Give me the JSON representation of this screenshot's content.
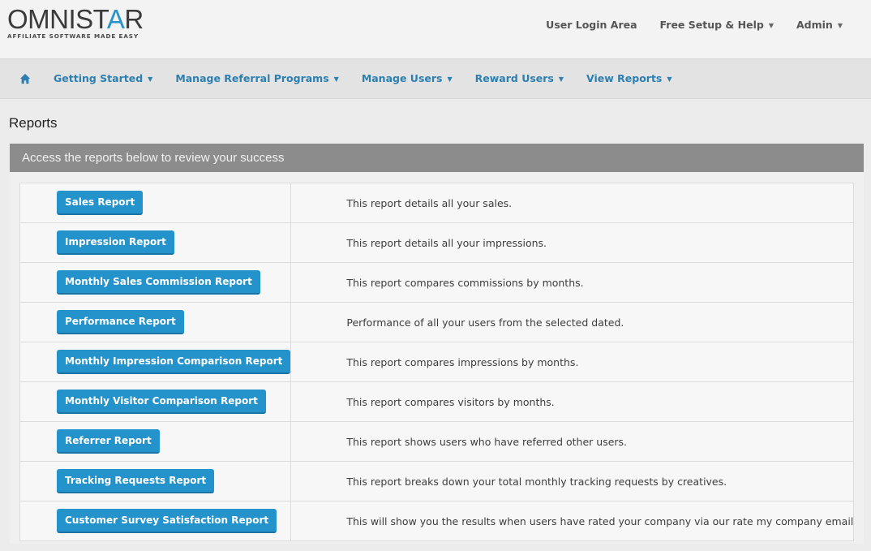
{
  "brand": {
    "name_part1": "OMNIST",
    "name_part2": "A",
    "name_part3": "R",
    "tagline": "AFFILIATE SOFTWARE MADE EASY"
  },
  "top_nav": {
    "user_login": "User Login Area",
    "setup_help": "Free Setup & Help",
    "admin": "Admin"
  },
  "main_nav": {
    "home_icon": "home-icon",
    "items": [
      {
        "label": "Getting Started"
      },
      {
        "label": "Manage Referral Programs"
      },
      {
        "label": "Manage Users"
      },
      {
        "label": "Reward Users"
      },
      {
        "label": "View Reports"
      }
    ]
  },
  "page": {
    "title": "Reports",
    "panel_header": "Access the reports below to review your success"
  },
  "reports": [
    {
      "button": "Sales Report",
      "description": "This report details all your sales."
    },
    {
      "button": "Impression Report",
      "description": "This report details all your impressions."
    },
    {
      "button": "Monthly Sales Commission Report",
      "description": "This report compares commissions by months."
    },
    {
      "button": "Performance Report",
      "description": "Performance of all your users from the selected dated."
    },
    {
      "button": "Monthly Impression Comparison Report",
      "description": "This report compares impressions by months."
    },
    {
      "button": "Monthly Visitor Comparison Report",
      "description": "This report compares visitors by months."
    },
    {
      "button": "Referrer Report",
      "description": "This report shows users who have referred other users."
    },
    {
      "button": "Tracking Requests Report",
      "description": "This report breaks down your total monthly tracking requests by creatives."
    },
    {
      "button": "Customer Survey Satisfaction Report",
      "description": "This will show you the results when users have rated your company via our rate my company email"
    }
  ],
  "colors": {
    "accent": "#2593cb",
    "nav_link": "#2d7fb0",
    "panel_header_bg": "#8c8c8c"
  }
}
